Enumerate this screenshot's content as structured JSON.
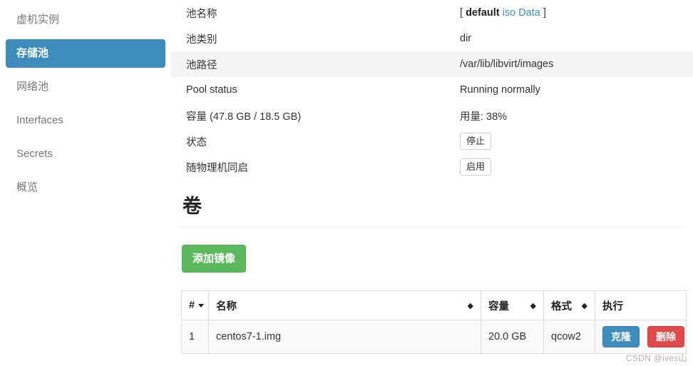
{
  "sidebar": {
    "items": [
      {
        "label": "虚机实例",
        "active": false
      },
      {
        "label": "存储池",
        "active": true
      },
      {
        "label": "网络池",
        "active": false
      },
      {
        "label": "Interfaces",
        "active": false
      },
      {
        "label": "Secrets",
        "active": false
      },
      {
        "label": "概览",
        "active": false
      }
    ]
  },
  "details": {
    "pool_name": {
      "label": "池名称",
      "bracket_open": "[",
      "current": "default",
      "links": [
        "iso",
        "Data"
      ],
      "bracket_close": "]"
    },
    "pool_type": {
      "label": "池类别",
      "value": "dir"
    },
    "pool_path": {
      "label": "池路径",
      "value": "/var/lib/libvirt/images"
    },
    "pool_status": {
      "label": "Pool status",
      "value": "Running normally"
    },
    "capacity": {
      "label": "容量 (47.8 GB / 18.5 GB)",
      "value": "用量: 38%"
    },
    "state": {
      "label": "状态",
      "button": "停止"
    },
    "autostart": {
      "label": "随物理机同启",
      "button": "启用"
    }
  },
  "volumes": {
    "heading": "卷",
    "add_button": "添加镜像",
    "columns": [
      {
        "label": "#",
        "sort": "desc"
      },
      {
        "label": "名称",
        "sort": "both"
      },
      {
        "label": "容量",
        "sort": "both"
      },
      {
        "label": "格式",
        "sort": "both"
      },
      {
        "label": "执行",
        "sort": "none"
      }
    ],
    "rows": [
      {
        "index": "1",
        "name": "centos7-1.img",
        "capacity": "20.0 GB",
        "format": "qcow2",
        "clone_label": "克隆",
        "delete_label": "删除"
      }
    ]
  },
  "watermark": {
    "text": "CSDN @ives山"
  },
  "colors": {
    "accent_blue": "#3c8dbc",
    "success_green": "#5cb85c",
    "danger_red": "#e04a4a",
    "stripe_gray": "#f5f5f5"
  }
}
